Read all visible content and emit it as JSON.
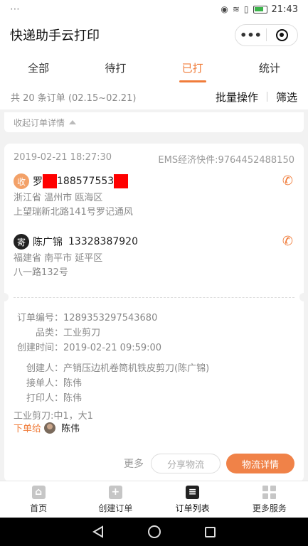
{
  "status_bar": {
    "time": "21:43",
    "notification_icon": "message-dots-icon"
  },
  "app": {
    "title": "快递助手云打印",
    "menu_glyph": "•••"
  },
  "tabs": [
    {
      "label": "全部"
    },
    {
      "label": "待打"
    },
    {
      "label": "已打",
      "active": true
    },
    {
      "label": "统计"
    }
  ],
  "filter": {
    "summary": "共 20 条订单 (02.15~02.21)",
    "batch": "批量操作",
    "filter": "筛选"
  },
  "collapse_text": "收起订单详情",
  "order": {
    "datetime": "2019-02-21 18:27:30",
    "express": "EMS经济快件:9764452488150",
    "receiver": {
      "badge": "收",
      "name_prefix": "罗",
      "phone": "188577553",
      "address_line1": "浙江省 温州市 瓯海区",
      "address_line2": "上望瑞新北路141号罗记通风"
    },
    "sender": {
      "badge": "寄",
      "name": "陈广锦",
      "phone": "13328387920",
      "address_line1": "福建省 南平市 延平区",
      "address_line2": "八一路132号"
    },
    "details": [
      {
        "key": "订单编号：",
        "value": "1289353297543680"
      },
      {
        "key": "品类：",
        "value": "工业剪刀"
      },
      {
        "key": "创建时间：",
        "value": "2019-02-21 09:59:00"
      }
    ],
    "people": [
      {
        "key": "创建人：",
        "value": "产销压边机卷筒机铁皮剪刀(陈广锦)"
      },
      {
        "key": "接单人：",
        "value": "陈伟"
      },
      {
        "key": "打印人：",
        "value": "陈伟"
      }
    ],
    "goods": "工业剪刀:中1，大1",
    "assign_label": "下单给",
    "assign_name": "陈伟",
    "more": "更多",
    "share_btn": "分享物流",
    "detail_btn": "物流详情"
  },
  "bottom_nav": [
    {
      "label": "首页",
      "icon": "home-icon"
    },
    {
      "label": "创建订单",
      "icon": "plus-box-icon"
    },
    {
      "label": "订单列表",
      "icon": "list-icon",
      "active": true
    },
    {
      "label": "更多服务",
      "icon": "grid-icon"
    }
  ],
  "colors": {
    "accent": "#f07c3a",
    "redaction": "#ff0000"
  }
}
